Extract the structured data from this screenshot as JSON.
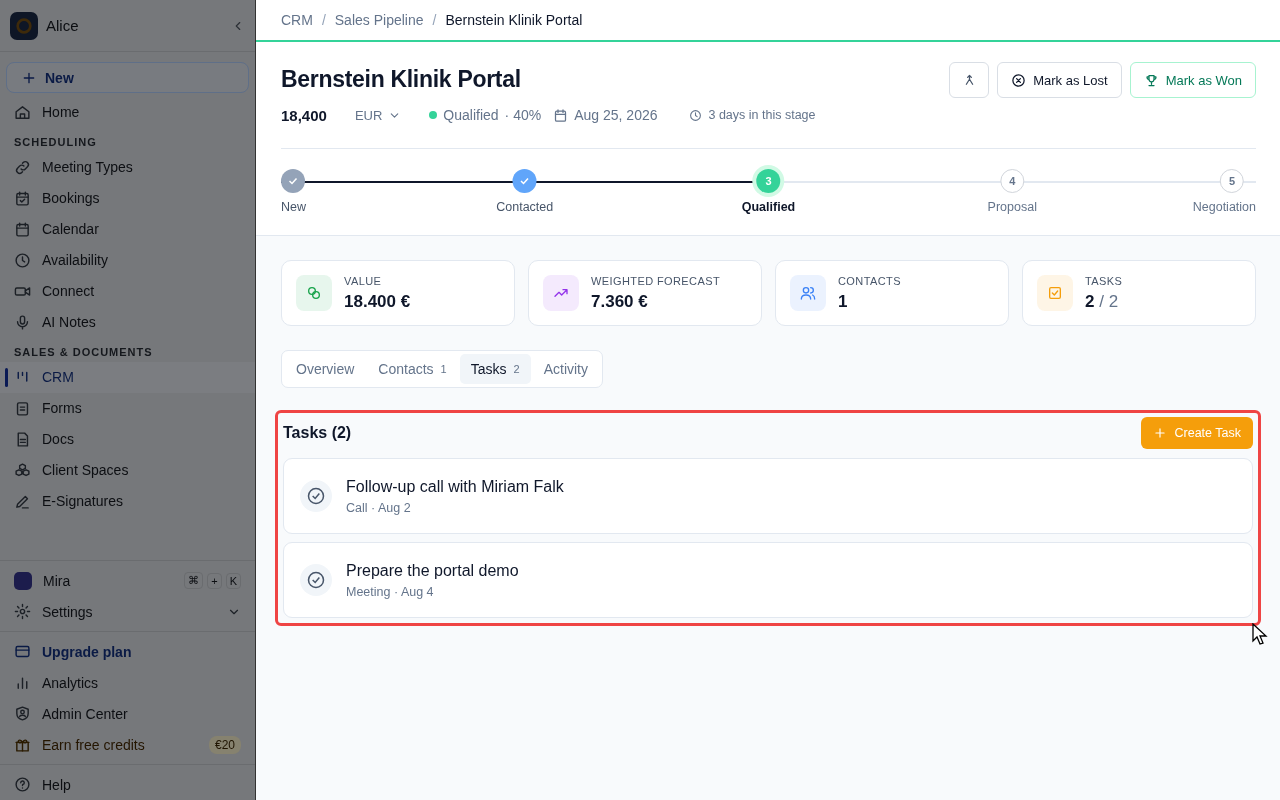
{
  "sidebar": {
    "workspace": "Alice",
    "new_button": "New",
    "groups": [
      {
        "items": [
          {
            "label": "Home",
            "selected": false
          }
        ]
      },
      {
        "heading": "SCHEDULING",
        "items": [
          {
            "label": "Meeting Types",
            "selected": false
          },
          {
            "label": "Bookings",
            "selected": false
          },
          {
            "label": "Calendar",
            "selected": false
          },
          {
            "label": "Availability",
            "selected": false
          },
          {
            "label": "Connect",
            "selected": false
          },
          {
            "label": "AI Notes",
            "selected": false
          }
        ]
      },
      {
        "heading": "SALES & DOCUMENTS",
        "items": [
          {
            "label": "CRM",
            "selected": true
          },
          {
            "label": "Forms",
            "selected": false
          },
          {
            "label": "Docs",
            "selected": false
          },
          {
            "label": "Client Spaces",
            "selected": false
          },
          {
            "label": "E-Signatures",
            "selected": false
          }
        ]
      }
    ],
    "assistant": {
      "label": "Mira",
      "keys": [
        "⌘",
        "+",
        "K"
      ]
    },
    "settings": {
      "label": "Settings",
      "expanded": false
    },
    "footer": [
      {
        "kind": "upgrade",
        "label": "Upgrade plan"
      },
      {
        "kind": "plain",
        "label": "Analytics"
      },
      {
        "kind": "plain",
        "label": "Admin Center"
      },
      {
        "kind": "credits",
        "label": "Earn free credits",
        "badge": "€20"
      }
    ],
    "help": "Help"
  },
  "breadcrumbs": {
    "separator": "/",
    "items": [
      "CRM",
      "Sales Pipeline",
      "Bernstein Klinik Portal"
    ]
  },
  "deal": {
    "title": "Bernstein Klinik Portal",
    "amount": "18,400",
    "currency": "EUR",
    "stage": "Qualified",
    "probability": "· 40%",
    "close_date": "Aug 25, 2026",
    "time_in_stage": "3 days in this stage",
    "buttons": [
      {
        "kind": "icon"
      },
      {
        "kind": "lost",
        "label": "Mark as Lost"
      },
      {
        "kind": "won",
        "label": "Mark as Won"
      }
    ]
  },
  "stepper": {
    "level": 0.5,
    "steps": [
      {
        "label": "New",
        "kind": "done",
        "color": "#94a3b8"
      },
      {
        "label": "Contacted",
        "kind": "done",
        "color": "#60a5fa"
      },
      {
        "label": "Qualified",
        "kind": "current",
        "number": "3"
      },
      {
        "label": "Proposal",
        "kind": "upcoming",
        "number": "4"
      },
      {
        "label": "Negotiation",
        "kind": "upcoming",
        "number": "5"
      }
    ]
  },
  "stats": [
    {
      "label": "VALUE",
      "value": "18.400 €",
      "color": "#16a34a"
    },
    {
      "label": "WEIGHTED FORECAST",
      "value": "7.360 €",
      "color": "#9333ea"
    },
    {
      "label": "CONTACTS",
      "value": "1",
      "color": "#3b82f6"
    },
    {
      "label": "TASKS",
      "value": "2",
      "total": "/ 2",
      "color": "#f59e0b"
    }
  ],
  "tabs": [
    {
      "label": "Overview",
      "selected": false
    },
    {
      "label": "Contacts",
      "count": "1",
      "selected": false
    },
    {
      "label": "Tasks",
      "count": "2",
      "selected": true
    },
    {
      "label": "Activity",
      "selected": false
    }
  ],
  "tasks": {
    "title": "Tasks (2)",
    "highlighted": true,
    "create_button": "Create Task",
    "items": [
      {
        "title": "Follow-up call with Miriam Falk",
        "meta": "Call · Aug 2"
      },
      {
        "title": "Prepare the portal demo",
        "meta": "Meeting · Aug 4"
      }
    ]
  }
}
